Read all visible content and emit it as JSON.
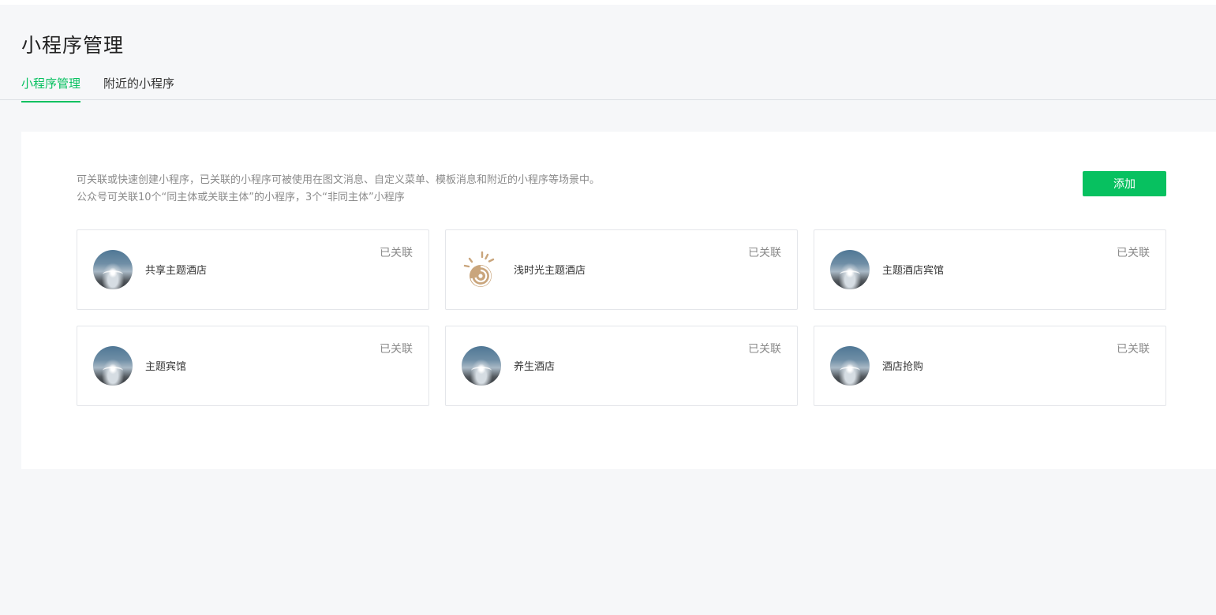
{
  "page": {
    "title": "小程序管理"
  },
  "tabs": [
    {
      "label": "小程序管理",
      "active": true
    },
    {
      "label": "附近的小程序",
      "active": false
    }
  ],
  "panel": {
    "description_line1": "可关联或快速创建小程序，已关联的小程序可被使用在图文消息、自定义菜单、模板消息和附近的小程序等场景中。",
    "description_line2": "公众号可关联10个“同主体或关联主体”的小程序，3个“非同主体”小程序",
    "add_button_label": "添加"
  },
  "cards": [
    {
      "name": "共享主题酒店",
      "status": "已关联",
      "avatar": "water-drop-icon"
    },
    {
      "name": "浅时光主题酒店",
      "status": "已关联",
      "avatar": "snail-sun-logo-icon"
    },
    {
      "name": "主题酒店宾馆",
      "status": "已关联",
      "avatar": "water-drop-icon"
    },
    {
      "name": "主题宾馆",
      "status": "已关联",
      "avatar": "water-drop-icon"
    },
    {
      "name": "养生酒店",
      "status": "已关联",
      "avatar": "water-drop-icon"
    },
    {
      "name": "酒店抢购",
      "status": "已关联",
      "avatar": "water-drop-icon"
    }
  ],
  "colors": {
    "accent": "#07c160",
    "page_background": "#f6f7f9",
    "muted_text": "#8a8a8a",
    "logo_tan": "#c9a57c"
  }
}
